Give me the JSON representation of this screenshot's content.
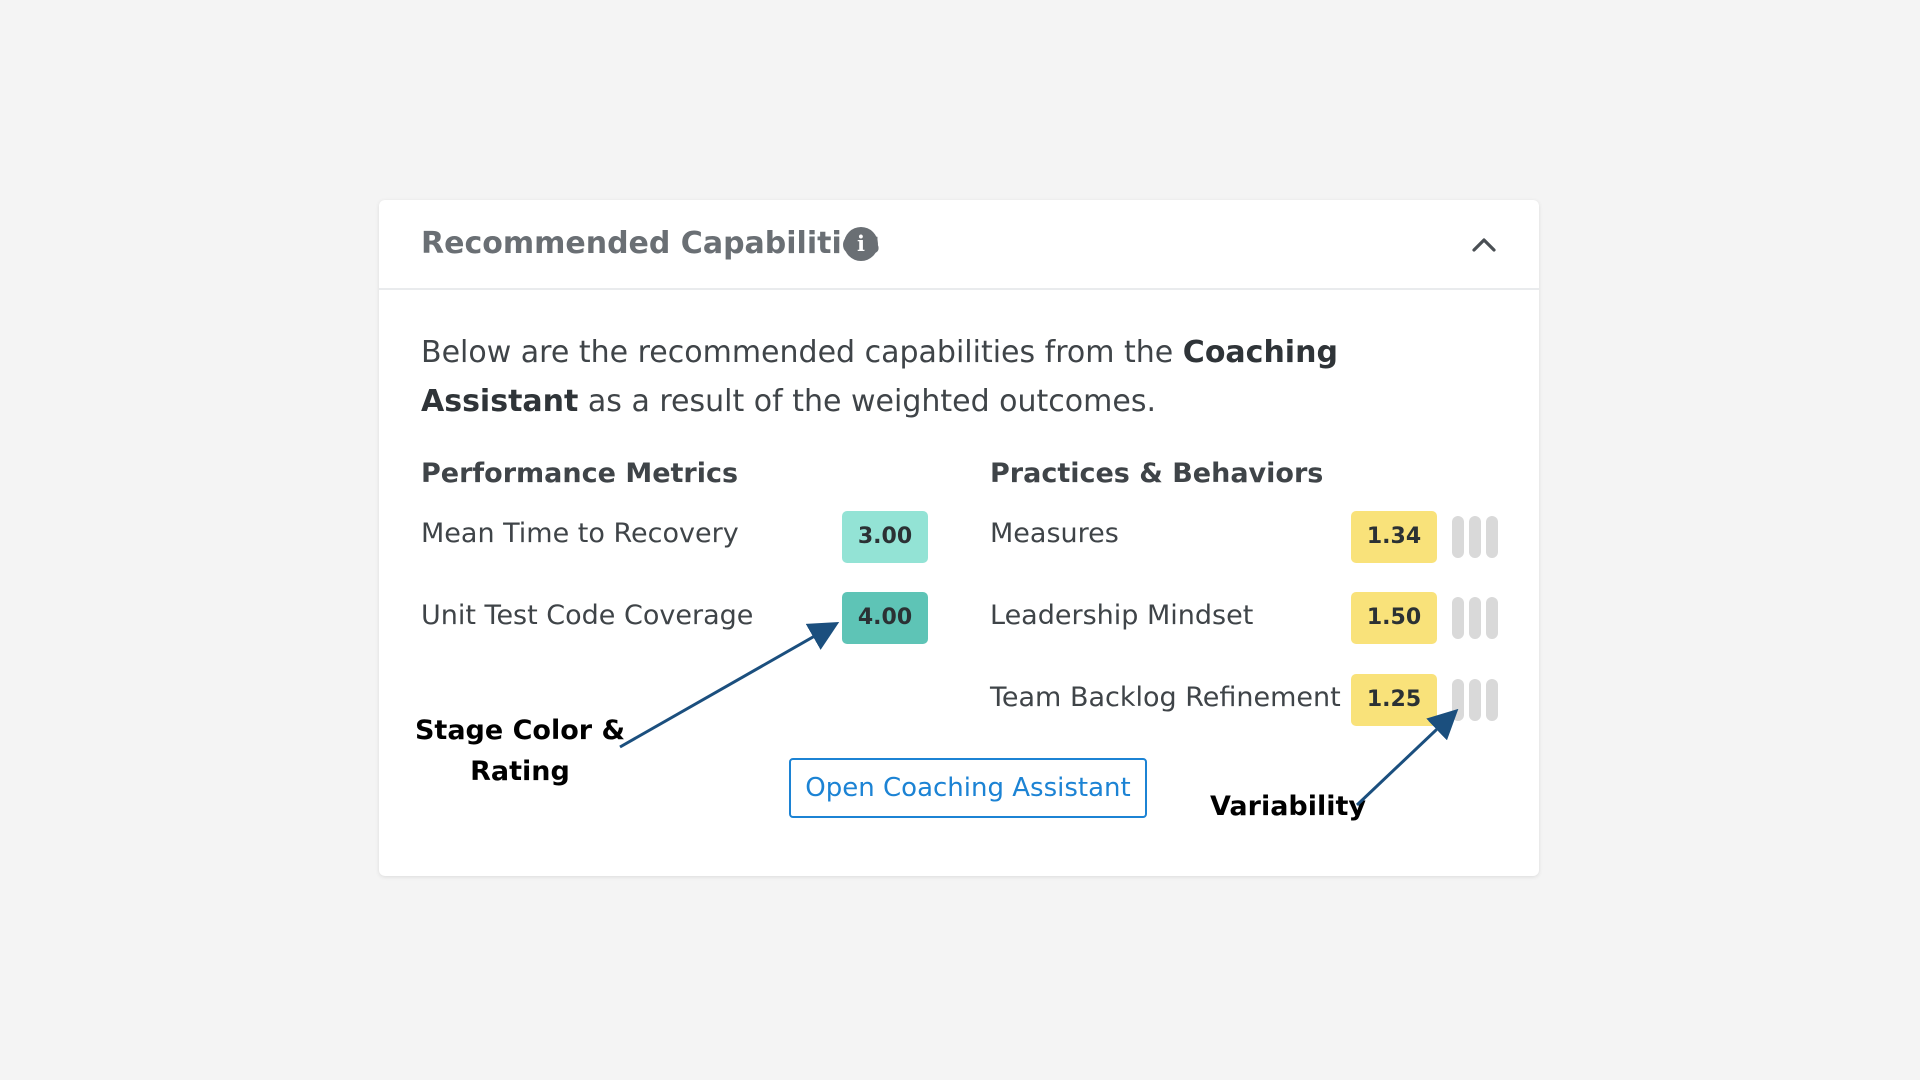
{
  "card": {
    "title": "Recommended Capabilities",
    "intro_text_1": "Below are the recommended capabilities from the ",
    "intro_bold": "Coaching Assistant",
    "intro_text_2": " as a result of the weighted outcomes."
  },
  "performance_metrics": {
    "heading": "Performance Metrics",
    "items": [
      {
        "label": "Mean Time to Recovery",
        "rating": "3.00",
        "color": "#93e3d5"
      },
      {
        "label": "Unit Test Code Coverage",
        "rating": "4.00",
        "color": "#5ec4b6"
      }
    ]
  },
  "practices_behaviors": {
    "heading": "Practices & Behaviors",
    "items": [
      {
        "label": "Measures",
        "rating": "1.34",
        "color": "#f9e27a"
      },
      {
        "label": "Leadership Mindset",
        "rating": "1.50",
        "color": "#f9e27a"
      },
      {
        "label": "Team Backlog Refinement",
        "rating": "1.25",
        "color": "#f9e27a"
      }
    ]
  },
  "open_button_label": "Open Coaching Assistant",
  "annotations": {
    "stage_line1": "Stage Color &",
    "stage_line2": "Rating",
    "variability": "Variability"
  },
  "icons": {
    "info": "info-icon",
    "collapse": "chevron-up-icon"
  },
  "colors": {
    "accent": "#1c83d4",
    "annotation_arrow": "#1b4f7e",
    "variability_bar": "#d9d9d9"
  }
}
